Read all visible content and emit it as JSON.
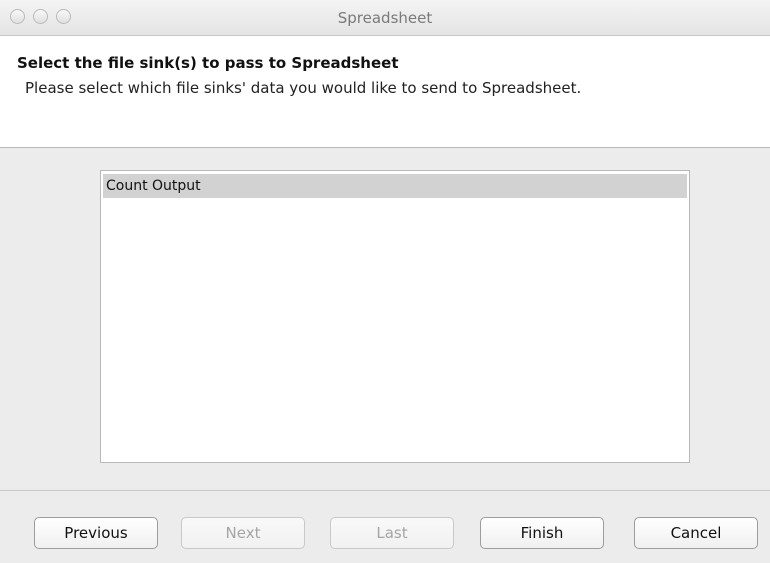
{
  "window": {
    "title": "Spreadsheet"
  },
  "header": {
    "title": "Select the file sink(s) to pass to Spreadsheet",
    "description": "Please select which file sinks' data you would like to send to Spreadsheet."
  },
  "list": {
    "items": [
      {
        "label": "Count Output",
        "selected": true
      }
    ]
  },
  "buttons": {
    "previous": "Previous",
    "next": "Next",
    "last": "Last",
    "finish": "Finish",
    "cancel": "Cancel"
  },
  "button_states": {
    "next_enabled": false,
    "last_enabled": false
  }
}
